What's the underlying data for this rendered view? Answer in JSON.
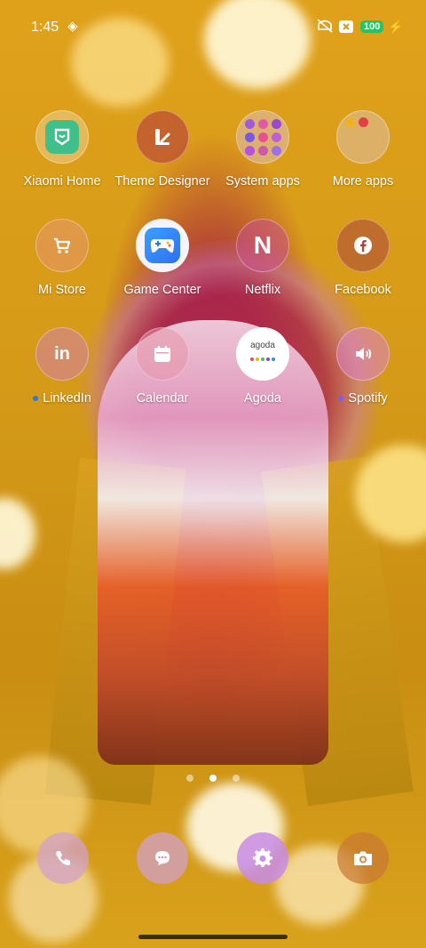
{
  "status": {
    "time": "1:45",
    "battery": "100"
  },
  "apps": [
    {
      "label": "Xiaomi Home",
      "icon": "xiaomi-home-icon"
    },
    {
      "label": "Theme Designer",
      "icon": "theme-designer-icon"
    },
    {
      "label": "System apps",
      "icon": "folder-icon"
    },
    {
      "label": "More apps",
      "icon": "folder-icon"
    },
    {
      "label": "Mi Store",
      "icon": "cart-icon"
    },
    {
      "label": "Game Center",
      "icon": "gamepad-icon"
    },
    {
      "label": "Netflix",
      "icon": "netflix-icon"
    },
    {
      "label": "Facebook",
      "icon": "facebook-icon"
    },
    {
      "label": "LinkedIn",
      "icon": "linkedin-icon"
    },
    {
      "label": "Calendar",
      "icon": "calendar-icon"
    },
    {
      "label": "Agoda",
      "icon": "agoda-icon",
      "icon_text": "agoda"
    },
    {
      "label": "Spotify",
      "icon": "spotify-icon"
    }
  ],
  "dock": [
    {
      "name": "phone",
      "icon": "phone-icon"
    },
    {
      "name": "messages",
      "icon": "message-icon"
    },
    {
      "name": "settings",
      "icon": "gear-icon"
    },
    {
      "name": "camera",
      "icon": "camera-icon"
    }
  ],
  "pager": {
    "pages": 3,
    "active": 2
  },
  "colors": {
    "linkedin_dot": "#2a7bd8",
    "spotify_dot": "#7a5cff",
    "battery": "#22c55e"
  }
}
